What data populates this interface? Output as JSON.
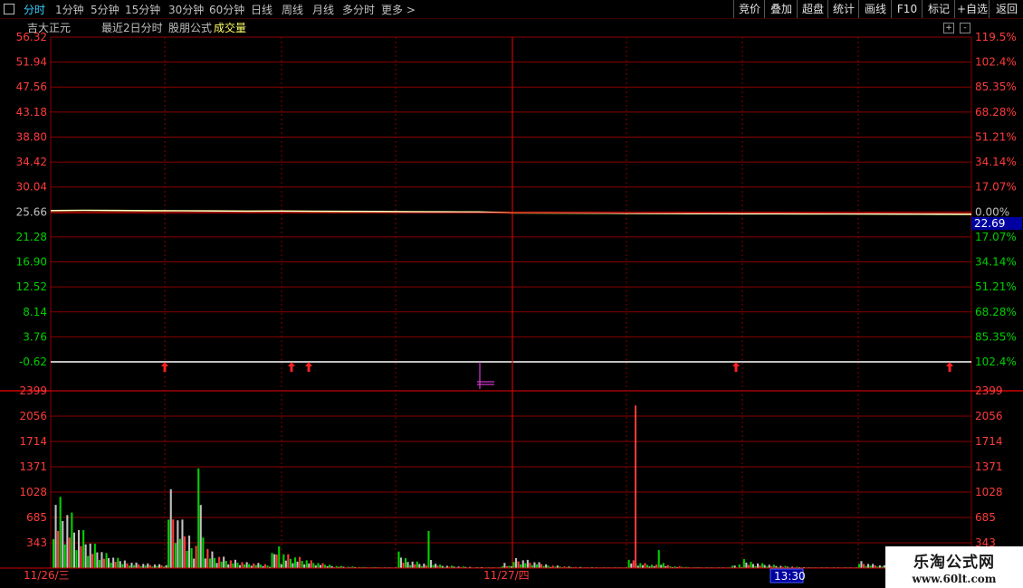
{
  "toolbar": {
    "tabs": [
      "分时",
      "1分钟",
      "5分钟",
      "15分钟",
      "30分钟",
      "60分钟",
      "日线",
      "周线",
      "月线",
      "多分时",
      "更多 >"
    ],
    "active_tab": 0,
    "right_buttons": [
      "竞价",
      "叠加",
      "超盘",
      "统计",
      "画线",
      "F10",
      "标记",
      "+自选",
      "返回"
    ]
  },
  "legend": {
    "stock_name": "吉大正元",
    "mode": "最近2日分时",
    "formula": "股朋公式",
    "indicator": "成交量"
  },
  "colors": {
    "up": "#ff3b3b",
    "down": "#00d000",
    "flat": "#c0c0c0",
    "price_line": "#ffffff",
    "avg_line": "#ffff66",
    "grid": "#8b0000",
    "price_box_bg": "#0000a0",
    "arrow": "#ff2020",
    "marker": "#ff40ff",
    "cursor_box_bg": "#0000a0"
  },
  "price_axis": {
    "left_labels": [
      "56.32",
      "51.94",
      "47.56",
      "43.18",
      "38.80",
      "34.42",
      "30.04",
      "25.66",
      "21.28",
      "16.90",
      "12.52",
      "8.14",
      "3.76",
      "-0.62"
    ],
    "right_labels": [
      "119.5%",
      "102.4%",
      "85.35%",
      "68.28%",
      "51.21%",
      "34.14%",
      "17.07%",
      "0.00%",
      "17.07%",
      "34.14%",
      "51.21%",
      "68.28%",
      "85.35%",
      "102.4%"
    ],
    "current_price": "22.69"
  },
  "volume_axis": {
    "labels": [
      "2399",
      "2056",
      "1714",
      "1371",
      "1028",
      "685",
      "343"
    ]
  },
  "date_axis": {
    "day1": "11/26/三",
    "day2": "11/27/四",
    "cursor_time": "13:30"
  },
  "watermark": {
    "title": "乐淘公式网",
    "url": "www.60lt.com"
  },
  "chart_data": {
    "type": "line",
    "title": "",
    "series": [
      {
        "name": "",
        "values": [
          25.9,
          25.95,
          25.92,
          25.88,
          25.86,
          25.84,
          25.8,
          25.82,
          25.78,
          25.76,
          25.74,
          25.7,
          25.68,
          25.66,
          25.5,
          25.48,
          25.46,
          25.44,
          25.4,
          25.38,
          25.36,
          25.35,
          25.34,
          25.33,
          25.32,
          25.3,
          25.28,
          25.26,
          25.25
        ]
      }
    ],
    "ylim": [
      -0.62,
      56.32
    ],
    "volume": [
      980,
      850,
      820,
      790,
      770,
      740,
      690,
      640,
      600,
      560,
      520,
      480,
      440,
      400,
      360,
      330,
      300,
      270,
      250,
      230,
      210,
      190,
      170,
      150,
      140,
      130,
      120,
      110,
      100,
      95,
      90,
      85,
      80,
      75,
      70,
      65,
      60,
      60,
      55,
      55,
      50,
      50,
      48,
      46,
      44,
      42,
      40,
      40,
      38,
      36,
      900,
      800,
      700,
      620,
      560,
      520,
      480,
      440,
      400,
      370,
      340,
      320,
      300,
      2200,
      700,
      500,
      300,
      250,
      200,
      180,
      160,
      150,
      140,
      130,
      120,
      110,
      100,
      95,
      90,
      85,
      80,
      75,
      70,
      65,
      60,
      58,
      56,
      54,
      52,
      50,
      48,
      46,
      44,
      42,
      40,
      200,
      300,
      150,
      350,
      120
    ],
    "volume_ylim": [
      0,
      2399
    ]
  }
}
